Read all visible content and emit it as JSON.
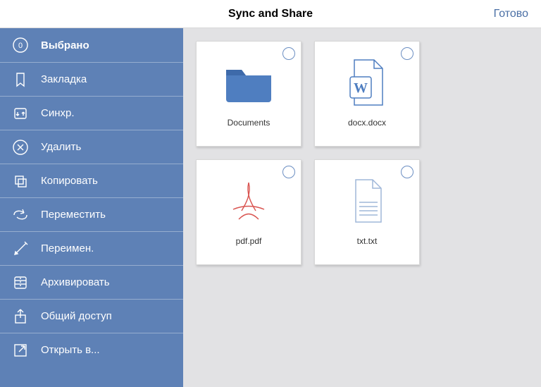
{
  "header": {
    "title": "Sync and Share",
    "done_label": "Готово"
  },
  "sidebar": {
    "items": [
      {
        "label": "Выбрано",
        "count": "0"
      },
      {
        "label": "Закладка"
      },
      {
        "label": "Синхр."
      },
      {
        "label": "Удалить"
      },
      {
        "label": "Копировать"
      },
      {
        "label": "Переместить"
      },
      {
        "label": "Переимен."
      },
      {
        "label": "Архивировать"
      },
      {
        "label": "Общий доступ"
      },
      {
        "label": "Открыть в..."
      }
    ]
  },
  "grid": {
    "items": [
      {
        "label": "Documents",
        "type": "folder"
      },
      {
        "label": "docx.docx",
        "type": "docx"
      },
      {
        "label": "pdf.pdf",
        "type": "pdf"
      },
      {
        "label": "txt.txt",
        "type": "txt"
      }
    ]
  }
}
